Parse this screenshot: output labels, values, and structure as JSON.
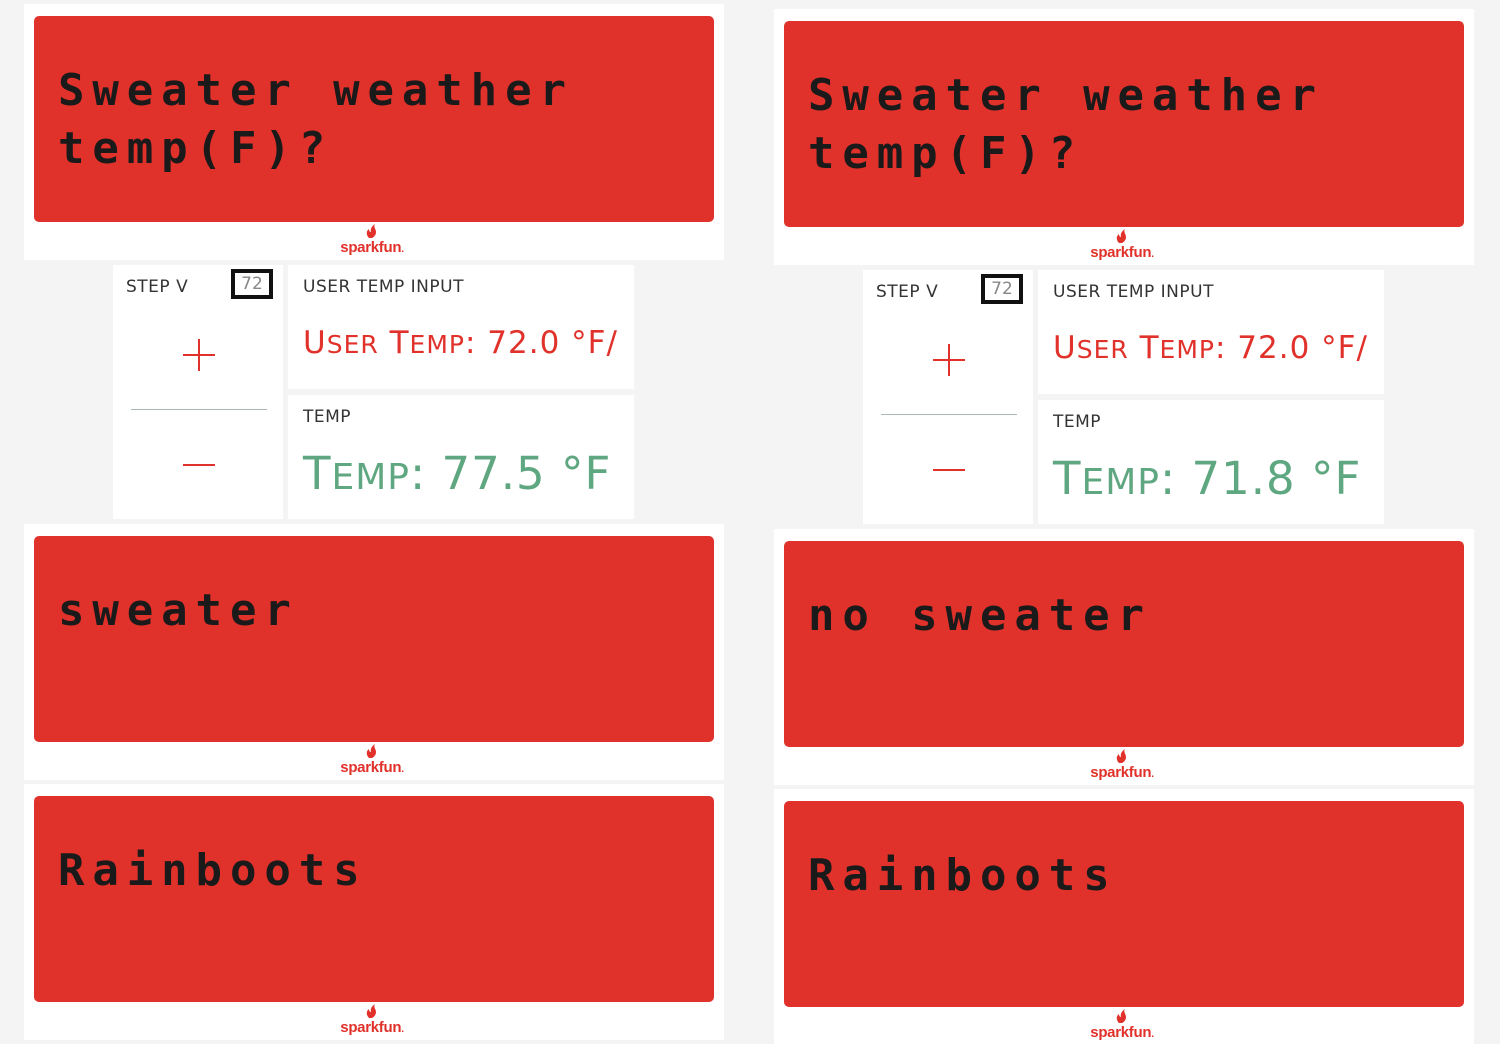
{
  "brand": {
    "logo_text": "sparkfun",
    "logo_dot": "."
  },
  "colors": {
    "lcd_red": "#e1312b",
    "user_temp_red": "#e1312b",
    "temp_green": "#5fa781"
  },
  "left": {
    "lcd_question": {
      "line1": "Sweater weather",
      "line2": "temp(F)?"
    },
    "step": {
      "label": "STEP V",
      "value": "72",
      "plus": "+",
      "minus": "−"
    },
    "user_temp_tile": {
      "title": "USER TEMP INPUT",
      "prefix_cap1": "U",
      "prefix_rest1": "SER",
      "prefix_cap2": "T",
      "prefix_rest2": "EMP",
      "value": ": 72.0 °F/"
    },
    "temp_tile": {
      "title": "TEMP",
      "prefix_cap": "T",
      "prefix_rest": "EMP",
      "value": ": 77.5 °F"
    },
    "lcd_result": {
      "line1": "sweater",
      "line2": ""
    },
    "lcd_boots": {
      "line1": "Rainboots",
      "line2": ""
    }
  },
  "right": {
    "lcd_question": {
      "line1": "Sweater weather",
      "line2": "temp(F)?"
    },
    "step": {
      "label": "STEP V",
      "value": "72",
      "plus": "+",
      "minus": "−"
    },
    "user_temp_tile": {
      "title": "USER TEMP INPUT",
      "prefix_cap1": "U",
      "prefix_rest1": "SER",
      "prefix_cap2": "T",
      "prefix_rest2": "EMP",
      "value": ": 72.0 °F/"
    },
    "temp_tile": {
      "title": "TEMP",
      "prefix_cap": "T",
      "prefix_rest": "EMP",
      "value": ": 71.8 °F"
    },
    "lcd_result": {
      "line1": "no sweater",
      "line2": ""
    },
    "lcd_boots": {
      "line1": "Rainboots",
      "line2": ""
    }
  }
}
